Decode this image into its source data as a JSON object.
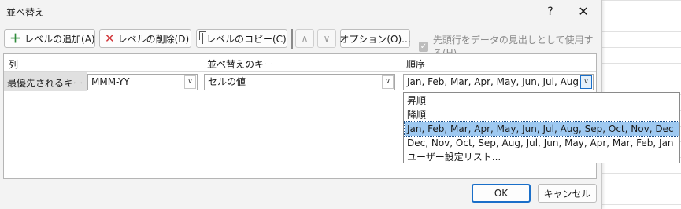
{
  "dialog": {
    "title": "並べ替え",
    "help_label": "?",
    "close_label": "✕"
  },
  "toolbar": {
    "add_level_label": "レベルの追加(A)",
    "delete_level_label": "レベルの削除(D)",
    "copy_level_label": "レベルのコピー(C)",
    "move_up_label": "∧",
    "move_down_label": "∨",
    "options_label": "オプション(O)...",
    "header_checkbox_label": "先頭行をデータの見出しとして使用する(H)",
    "header_checkbox_checked": true
  },
  "grid": {
    "columns": [
      "列",
      "並べ替えのキー",
      "順序"
    ],
    "rows": [
      {
        "label": "最優先されるキー",
        "column_value": "MMM-YY",
        "key_value": "セルの値",
        "order_value": "Jan, Feb, Mar, Apr, May, Jun, Jul, Aug"
      }
    ]
  },
  "order_dropdown": {
    "options": [
      "昇順",
      "降順",
      "Jan, Feb, Mar, Apr, May, Jun, Jul, Aug, Sep, Oct, Nov, Dec",
      "Dec, Nov, Oct, Sep, Aug, Jul, Jun, May, Apr, Mar, Feb, Jan",
      "ユーザー設定リスト..."
    ],
    "selected_index": 2
  },
  "footer": {
    "ok_label": "OK",
    "cancel_label": "キャンセル"
  },
  "colors": {
    "accent": "#1a6fc9",
    "selection": "#9ec9f1",
    "dialog_bg": "#f3f3f3"
  }
}
